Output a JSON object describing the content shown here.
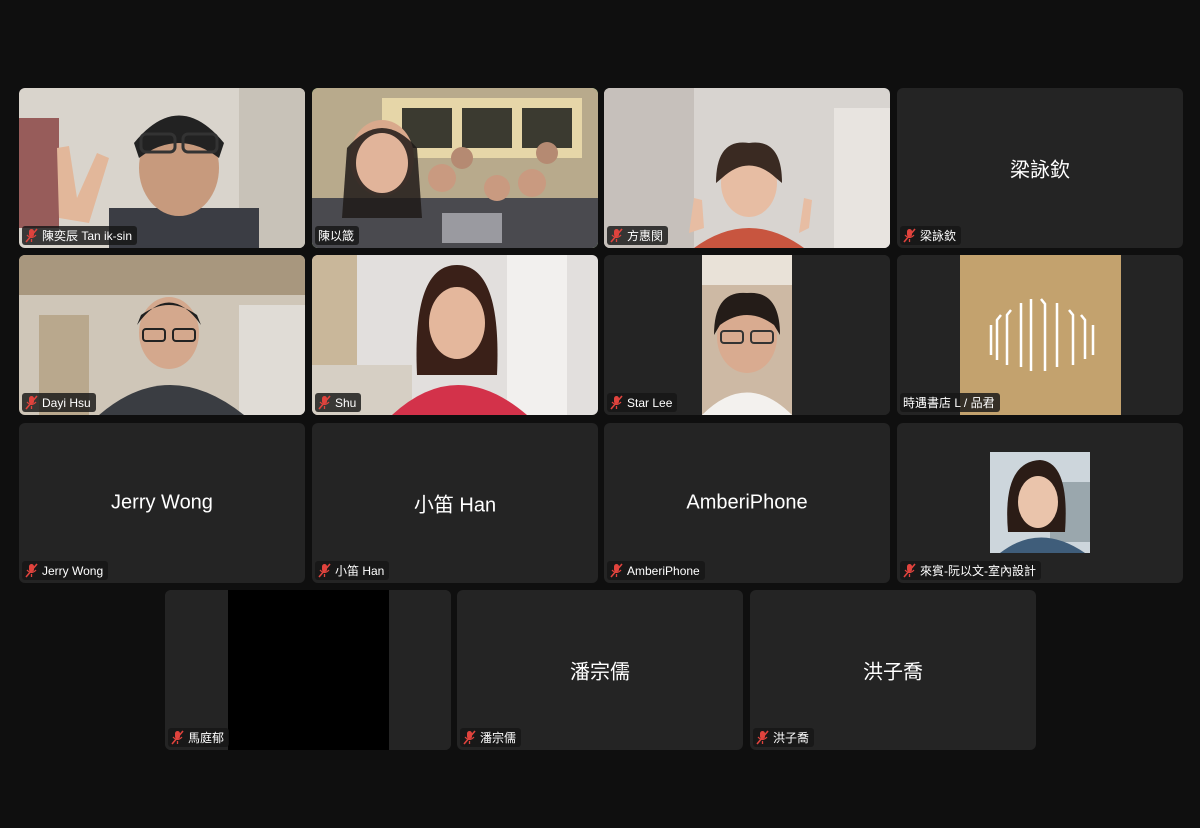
{
  "meeting": {
    "colors": {
      "background": "#0f0f0f",
      "tile": "#242424",
      "active_speaker_border": "#3ec24f",
      "muted_icon": "#e0433d"
    },
    "participants": [
      {
        "name": "陳奕辰 Tan ik-sin",
        "video": true,
        "muted": true,
        "active": false
      },
      {
        "name": "陳以箴",
        "video": true,
        "muted": false,
        "active": true
      },
      {
        "name": "方惠閔",
        "video": true,
        "muted": true,
        "active": false
      },
      {
        "name": "梁詠欽",
        "display_name": "梁詠欽",
        "video": false,
        "muted": true,
        "active": false
      },
      {
        "name": "Dayi Hsu",
        "video": true,
        "muted": true,
        "active": false
      },
      {
        "name": "Shu",
        "video": true,
        "muted": true,
        "active": false
      },
      {
        "name": "Star Lee",
        "video": true,
        "muted": true,
        "active": false
      },
      {
        "name": "時遇書店 L / 品君",
        "video": true,
        "muted": false,
        "active": false
      },
      {
        "name": "Jerry Wong",
        "display_name": "Jerry Wong",
        "video": false,
        "muted": true,
        "active": false
      },
      {
        "name": "小笛 Han",
        "display_name": "小笛 Han",
        "video": false,
        "muted": true,
        "active": false
      },
      {
        "name": "AmberiPhone",
        "display_name": "AmberiPhone",
        "video": false,
        "muted": true,
        "active": false
      },
      {
        "name": "來賓-阮以文-室內設計",
        "video": false,
        "avatar": true,
        "muted": true,
        "active": false
      },
      {
        "name": "馬庭郁",
        "video": true,
        "muted": true,
        "active": false
      },
      {
        "name": "潘宗儒",
        "display_name": "潘宗儒",
        "video": false,
        "muted": true,
        "active": false
      },
      {
        "name": "洪子喬",
        "display_name": "洪子喬",
        "video": false,
        "muted": true,
        "active": false
      }
    ]
  }
}
